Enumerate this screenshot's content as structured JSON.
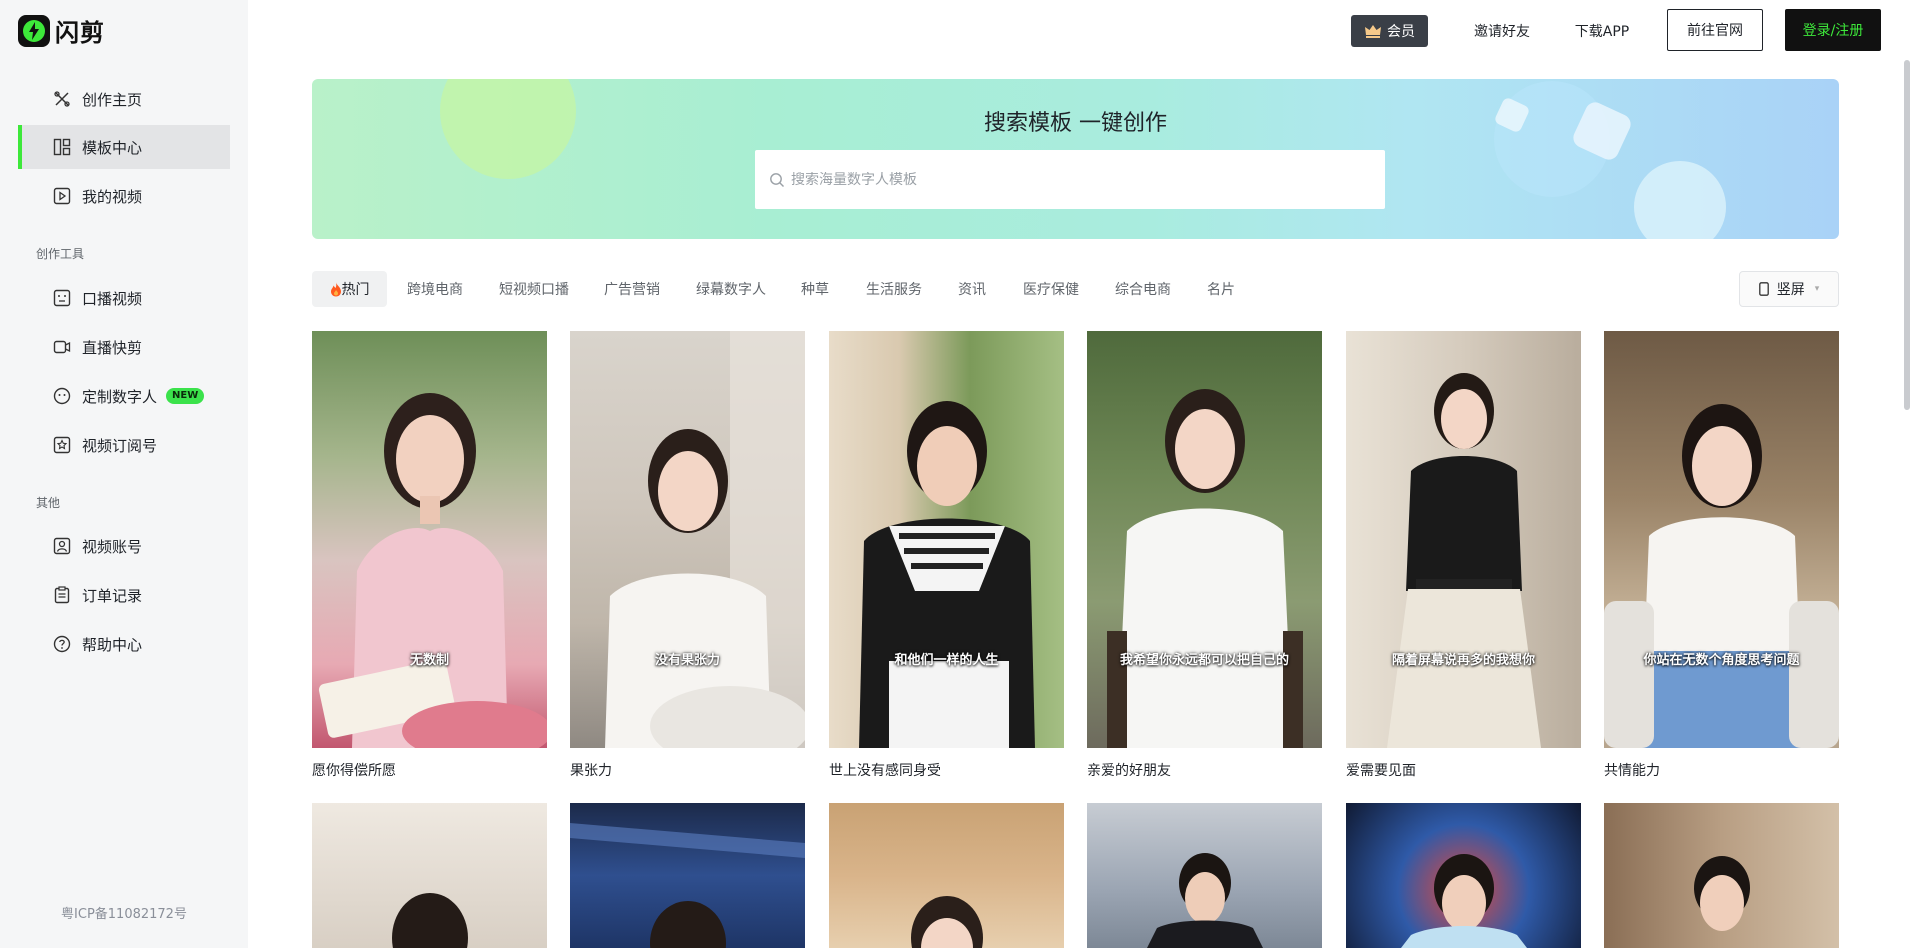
{
  "brand": {
    "name": "闪剪"
  },
  "sidebar": {
    "primary": [
      {
        "label": "创作主页",
        "icon": "create-icon",
        "active": false
      },
      {
        "label": "模板中心",
        "icon": "template-icon",
        "active": true
      },
      {
        "label": "我的视频",
        "icon": "video-icon",
        "active": false
      }
    ],
    "tools_title": "创作工具",
    "tools": [
      {
        "label": "口播视频",
        "icon": "talk-video-icon"
      },
      {
        "label": "直播快剪",
        "icon": "live-clip-icon"
      },
      {
        "label": "定制数字人",
        "icon": "avatar-face-icon",
        "badge": "NEW"
      },
      {
        "label": "视频订阅号",
        "icon": "subscribe-icon"
      }
    ],
    "other_title": "其他",
    "other": [
      {
        "label": "视频账号",
        "icon": "account-icon"
      },
      {
        "label": "订单记录",
        "icon": "order-icon"
      },
      {
        "label": "帮助中心",
        "icon": "help-icon"
      }
    ],
    "icp": "粤ICP备11082172号"
  },
  "topbar": {
    "vip": "会员",
    "invite": "邀请好友",
    "download": "下载APP",
    "official": "前往官网",
    "login": "登录/注册"
  },
  "banner": {
    "title": "搜索模板 一键创作",
    "search_placeholder": "搜索海量数字人模板"
  },
  "tabs": [
    "热门",
    "跨境电商",
    "短视频口播",
    "广告营销",
    "绿幕数字人",
    "种草",
    "生活服务",
    "资讯",
    "医疗保健",
    "综合电商",
    "名片"
  ],
  "orientation": "竖屏",
  "cards": [
    {
      "title": "愿你得偿所愿",
      "caption": "无数制"
    },
    {
      "title": "果张力",
      "caption": "没有果张力"
    },
    {
      "title": "世上没有感同身受",
      "caption": "和他们一样的人生"
    },
    {
      "title": "亲爱的好朋友",
      "caption": "我希望你永远都可以把自己的"
    },
    {
      "title": "爱需要见面",
      "caption": "隔着屏幕说再多的我想你"
    },
    {
      "title": "共情能力",
      "caption": "你站在无数个角度思考问题"
    }
  ],
  "colors": {
    "accent_green": "#3de83a",
    "login_bg": "#111111",
    "login_text": "#3de83a",
    "vip_bg": "#3a3f47"
  }
}
